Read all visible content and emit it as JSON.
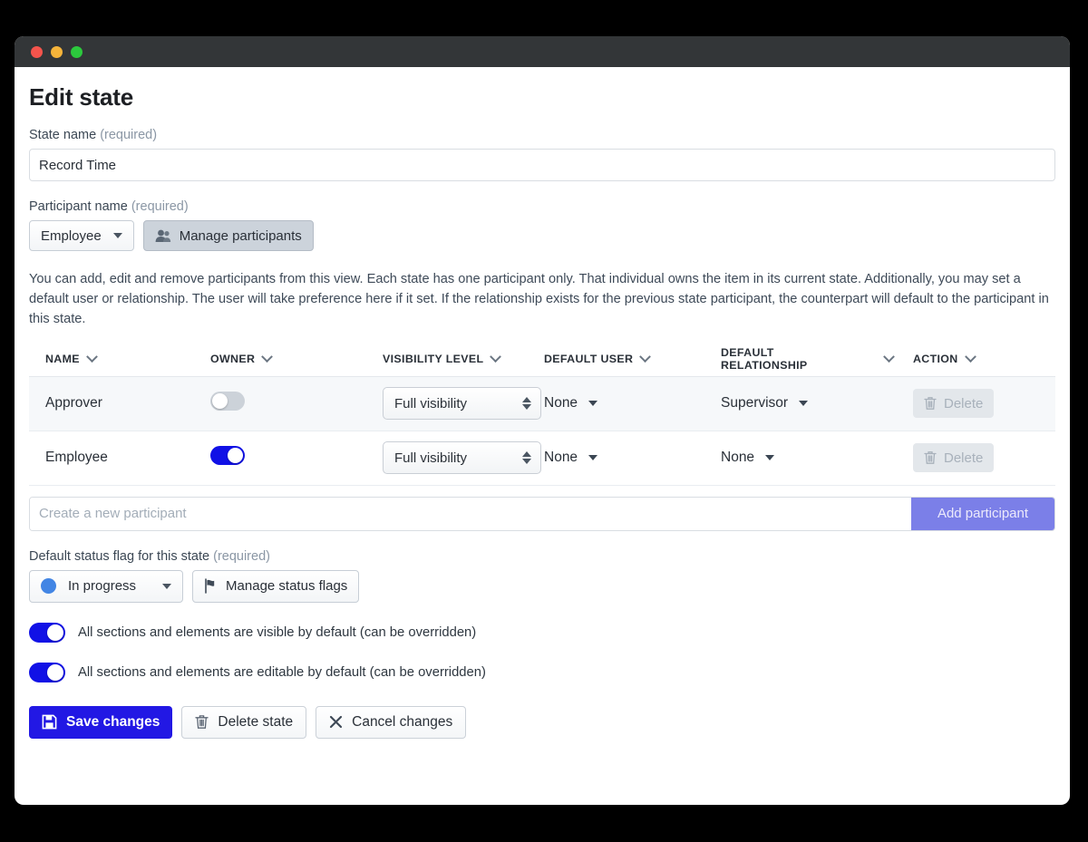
{
  "window": {
    "traffic_lights": [
      "close",
      "minimize",
      "maximize"
    ]
  },
  "page": {
    "title": "Edit state"
  },
  "state_name": {
    "label": "State name",
    "required_text": "(required)",
    "value": "Record Time"
  },
  "participant_name": {
    "label": "Participant name",
    "required_text": "(required)",
    "selected": "Employee",
    "manage_button": "Manage participants"
  },
  "description": "You can add, edit and remove participants from this view. Each state has one participant only. That individual owns the item in its current state. Additionally, you may set a default user or relationship. The user will take preference here if it set. If the relationship exists for the previous state participant, the counterpart will default to the participant in this state.",
  "table": {
    "columns": [
      "NAME",
      "OWNER",
      "VISIBILITY LEVEL",
      "DEFAULT USER",
      "DEFAULT RELATIONSHIP",
      "ACTION"
    ],
    "rows": [
      {
        "name": "Approver",
        "owner_on": false,
        "visibility": "Full visibility",
        "default_user": "None",
        "default_relationship": "Supervisor",
        "action": "Delete"
      },
      {
        "name": "Employee",
        "owner_on": true,
        "visibility": "Full visibility",
        "default_user": "None",
        "default_relationship": "None",
        "action": "Delete"
      }
    ]
  },
  "add_participant": {
    "placeholder": "Create a new participant",
    "value": "",
    "button": "Add participant"
  },
  "status_flag": {
    "label": "Default status flag for this state",
    "required_text": "(required)",
    "selected": "In progress",
    "dot_color": "#4285e4",
    "manage_button": "Manage status flags"
  },
  "toggles": [
    {
      "on": true,
      "label": "All sections and elements are visible by default (can be overridden)"
    },
    {
      "on": true,
      "label": "All sections and elements are editable by default (can be overridden)"
    }
  ],
  "footer": {
    "save": "Save changes",
    "delete": "Delete state",
    "cancel": "Cancel changes"
  },
  "colors": {
    "primary_blue": "#2218e4",
    "toggle_blue": "#1111e6",
    "add_button": "#7b7fe8",
    "status_dot": "#4285e4",
    "titlebar": "#333638"
  }
}
